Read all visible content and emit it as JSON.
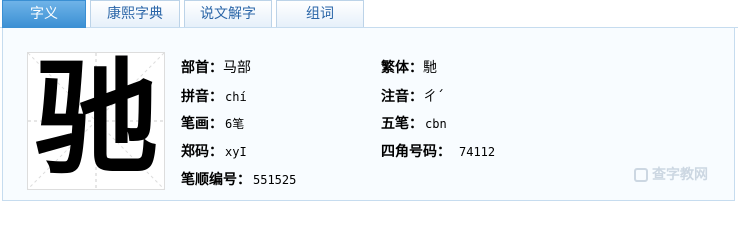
{
  "tabs": [
    {
      "label": "字义",
      "active": true
    },
    {
      "label": "康熙字典",
      "active": false
    },
    {
      "label": "说文解字",
      "active": false
    },
    {
      "label": "组词",
      "active": false
    }
  ],
  "glyph": "驰",
  "info": {
    "radical_label": "部首：",
    "radical_value": "马部",
    "traditional_label": "繁体：",
    "traditional_value": "馳",
    "pinyin_label": "拼音：",
    "pinyin_value": "chí",
    "zhuyin_label": "注音：",
    "zhuyin_value": "ㄔˊ",
    "strokes_label": "笔画：",
    "strokes_value": "6笔",
    "wubi_label": "五笔：",
    "wubi_value": "cbn",
    "zhengma_label": "郑码：",
    "zhengma_value": "xyI",
    "fourcorner_label": "四角号码：",
    "fourcorner_value": "74112",
    "stroke_order_label": "笔顺编号：",
    "stroke_order_value": "551525"
  },
  "watermark": "查字教网",
  "colors": {
    "active_tab": "#3a8fd3",
    "tab_text": "#2b66a8",
    "border": "#c6dcef",
    "grid_line": "#cccccc"
  }
}
